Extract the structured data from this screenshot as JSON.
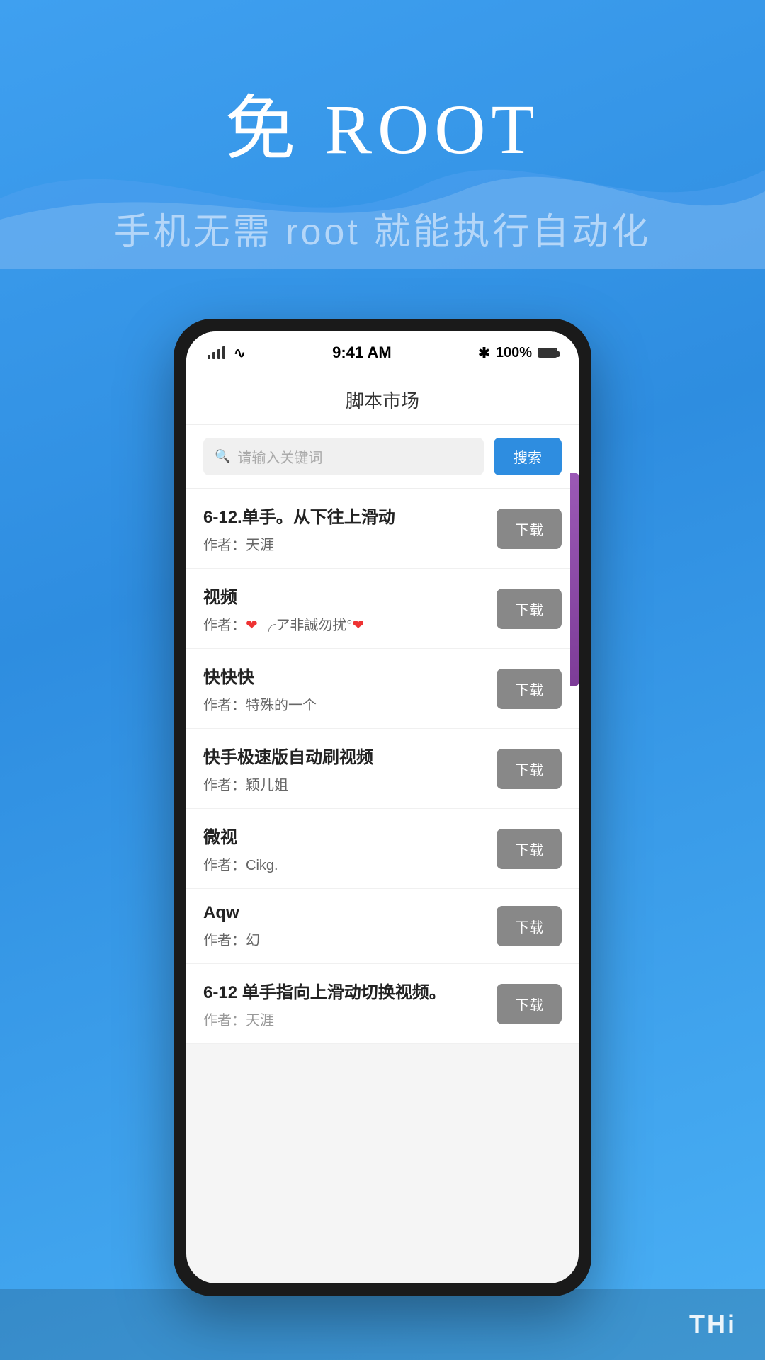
{
  "hero": {
    "title": "免 ROOT",
    "subtitle": "手机无需 root 就能执行自动化"
  },
  "status_bar": {
    "time": "9:41 AM",
    "battery": "100%",
    "bluetooth": "✱"
  },
  "app": {
    "title": "脚本市场",
    "search_placeholder": "请输入关键词",
    "search_button": "搜索"
  },
  "scripts": [
    {
      "name": "6-12.单手。从下往上滑动",
      "author": "作者：天涯",
      "download_label": "下载"
    },
    {
      "name": "视频",
      "author_prefix": "作者：",
      "author_content": "❤ ╭ア非誠勿扰°❤",
      "download_label": "下载"
    },
    {
      "name": "快快快",
      "author": "作者：特殊的一个",
      "download_label": "下载"
    },
    {
      "name": "快手极速版自动刷视频",
      "author": "作者：颖儿姐",
      "download_label": "下载"
    },
    {
      "name": "微视",
      "author": "作者：Cikg.",
      "download_label": "下载"
    },
    {
      "name": "Aqw",
      "author": "作者：幻",
      "download_label": "下载"
    },
    {
      "name": "6-12 单手指向上滑动切换视频。",
      "author": "作者：天涯",
      "download_label": "下载"
    }
  ],
  "watermark": "THi",
  "colors": {
    "bg_gradient_start": "#3fa0f0",
    "bg_gradient_end": "#2e8de0",
    "search_btn": "#2e8de0",
    "download_btn": "#888888",
    "phone_frame": "#1a1a1a"
  }
}
